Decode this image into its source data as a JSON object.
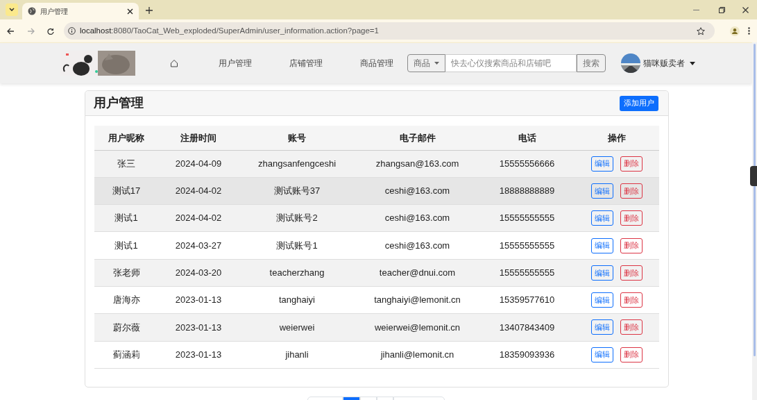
{
  "browser": {
    "tab_title": "用户管理",
    "url_host": "localhost",
    "url_rest": ":8080/TaoCat_Web_exploded/SuperAdmin/user_information.action?page=1"
  },
  "navbar": {
    "links": [
      {
        "label": "用户管理"
      },
      {
        "label": "店铺管理"
      },
      {
        "label": "商品管理"
      }
    ],
    "search": {
      "category": "商品",
      "placeholder": "快去心仪搜索商品和店铺吧",
      "button": "搜索"
    },
    "user": "猫咪贩卖者"
  },
  "card": {
    "title": "用户管理",
    "add_button": "添加用户",
    "table": {
      "columns": [
        "用户昵称",
        "注册时间",
        "账号",
        "电子邮件",
        "电话",
        "操作"
      ],
      "rows": [
        {
          "cells": [
            "张三",
            "2024-04-09",
            "zhangsanfengceshi",
            "zhangsan@163.com",
            "15555556666"
          ],
          "hovered": false,
          "edit": "编辑",
          "delete": "删除"
        },
        {
          "cells": [
            "测试17",
            "2024-04-02",
            "测试账号37",
            "ceshi@163.com",
            "18888888889"
          ],
          "hovered": true,
          "edit": "编辑",
          "delete": "删除"
        },
        {
          "cells": [
            "测试1",
            "2024-04-02",
            "测试账号2",
            "ceshi@163.com",
            "15555555555"
          ],
          "hovered": false,
          "edit": "编辑",
          "delete": "删除"
        },
        {
          "cells": [
            "测试1",
            "2024-03-27",
            "测试账号1",
            "ceshi@163.com",
            "15555555555"
          ],
          "hovered": false,
          "edit": "编辑",
          "delete": "删除"
        },
        {
          "cells": [
            "张老师",
            "2024-03-20",
            "teacherzhang",
            "teacher@dnui.com",
            "15555555555"
          ],
          "hovered": false,
          "edit": "编辑",
          "delete": "删除"
        },
        {
          "cells": [
            "唐海亦",
            "2023-01-13",
            "tanghaiyi",
            "tanghaiyi@lemonit.cn",
            "15359577610"
          ],
          "hovered": false,
          "edit": "编辑",
          "delete": "删除"
        },
        {
          "cells": [
            "蔚尔薇",
            "2023-01-13",
            "weierwei",
            "weierwei@lemonit.cn",
            "13407843409"
          ],
          "hovered": false,
          "edit": "编辑",
          "delete": "删除"
        },
        {
          "cells": [
            "蓟涵莉",
            "2023-01-13",
            "jihanli",
            "jihanli@lemonit.cn",
            "18359093936"
          ],
          "hovered": false,
          "edit": "编辑",
          "delete": "删除"
        }
      ]
    }
  },
  "pagination": [
    {
      "selected": false
    },
    {
      "selected": true
    },
    {
      "selected": false
    },
    {
      "selected": false
    },
    {
      "selected": false
    }
  ]
}
